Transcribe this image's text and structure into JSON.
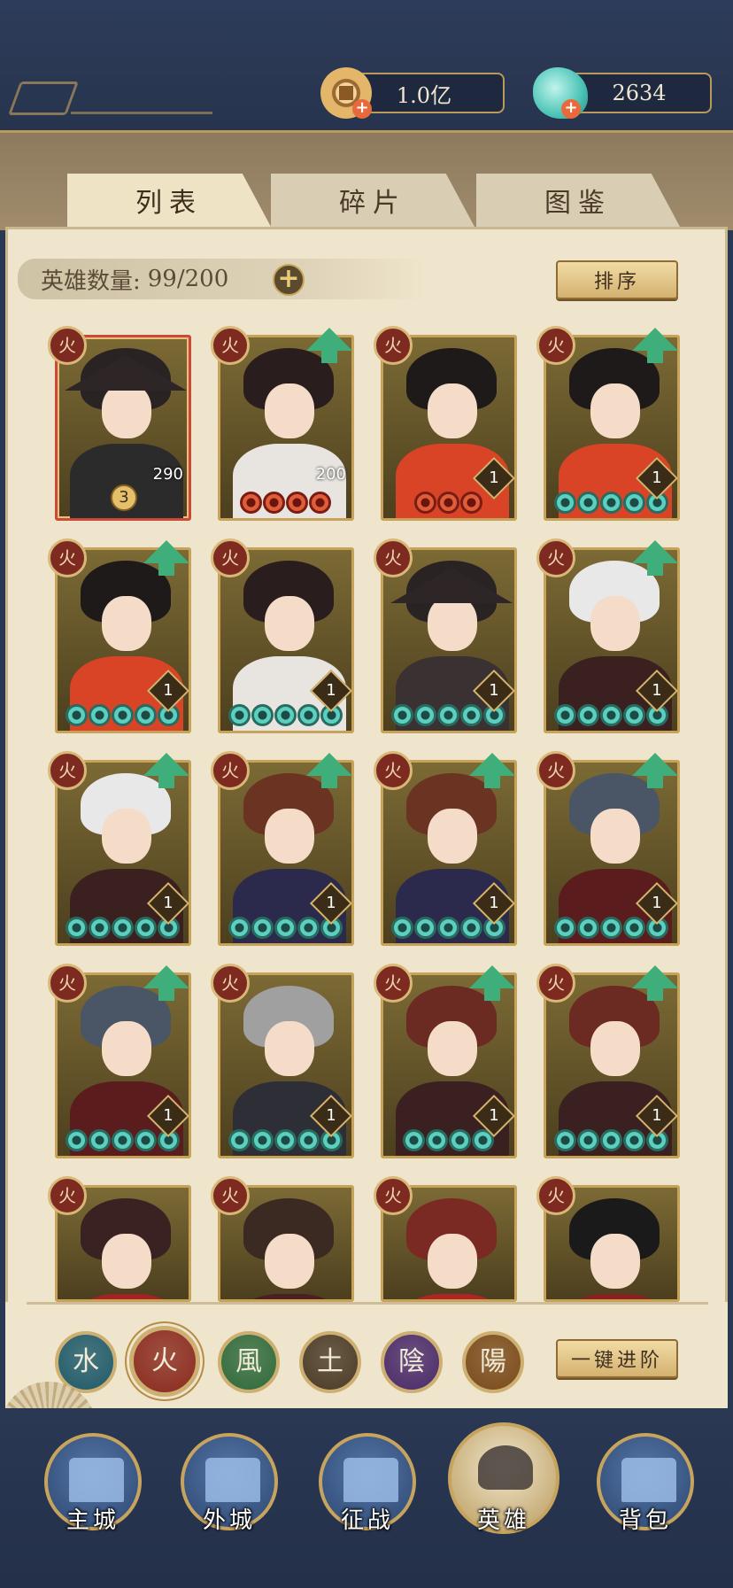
{
  "resources": {
    "coin": {
      "value": "1.0亿",
      "icon": "copper-coin-icon"
    },
    "jade": {
      "value": "2634",
      "icon": "jade-icon"
    }
  },
  "tabs": [
    {
      "label": "列表",
      "active": true
    },
    {
      "label": "碎片",
      "active": false
    },
    {
      "label": "图鉴",
      "active": false
    }
  ],
  "hero_count": {
    "label": "英雄数量:",
    "value": "99/200"
  },
  "sort_label": "排序",
  "onekey_label": "一键进阶",
  "element_glyph": "火",
  "heroes": [
    {
      "row": 0,
      "shards": "290",
      "stars": "3",
      "beads": [],
      "upgrade": false,
      "frame": "red",
      "hair": "#2a2324",
      "robe": "#2b2b2b",
      "hat": true
    },
    {
      "row": 0,
      "shards": "200",
      "level": null,
      "beads": [
        "red",
        "red",
        "red",
        "red"
      ],
      "upgrade": true,
      "frame": "gold",
      "hair": "#2a1d1e",
      "robe": "#e8e4df"
    },
    {
      "row": 0,
      "level": "1",
      "beads": [
        "red",
        "red",
        "red"
      ],
      "upgrade": false,
      "frame": "gold",
      "hair": "#1e1a1a",
      "robe": "#d84425"
    },
    {
      "row": 0,
      "level": "1",
      "beads": [
        "jade",
        "jade",
        "jade",
        "jade",
        "jade"
      ],
      "upgrade": true,
      "frame": "gold",
      "hair": "#1e1a1a",
      "robe": "#d84425"
    },
    {
      "row": 1,
      "level": "1",
      "beads": [
        "jade",
        "jade",
        "jade",
        "jade",
        "jade"
      ],
      "upgrade": true,
      "frame": "gold",
      "hair": "#1e1a1a",
      "robe": "#d84425"
    },
    {
      "row": 1,
      "level": "1",
      "beads": [
        "jade",
        "jade",
        "jade",
        "jade",
        "jade"
      ],
      "upgrade": false,
      "frame": "gold",
      "hair": "#2a1d1e",
      "robe": "#e8e4df"
    },
    {
      "row": 1,
      "level": "1",
      "beads": [
        "jade",
        "jade",
        "jade",
        "jade",
        "jade"
      ],
      "upgrade": false,
      "frame": "gold",
      "hair": "#2a2324",
      "robe": "#3a3232",
      "hat": true
    },
    {
      "row": 1,
      "level": "1",
      "beads": [
        "jade",
        "jade",
        "jade",
        "jade",
        "jade"
      ],
      "upgrade": true,
      "frame": "gold",
      "hair": "#e8e8e8",
      "robe": "#3b2020"
    },
    {
      "row": 2,
      "level": "1",
      "beads": [
        "jade",
        "jade",
        "jade",
        "jade",
        "jade"
      ],
      "upgrade": true,
      "frame": "gold",
      "hair": "#e8e8e8",
      "robe": "#3b2020"
    },
    {
      "row": 2,
      "level": "1",
      "beads": [
        "jade",
        "jade",
        "jade",
        "jade",
        "jade"
      ],
      "upgrade": true,
      "frame": "gold",
      "hair": "#6b3422",
      "robe": "#2c2a4c"
    },
    {
      "row": 2,
      "level": "1",
      "beads": [
        "jade",
        "jade",
        "jade",
        "jade",
        "jade"
      ],
      "upgrade": true,
      "frame": "gold",
      "hair": "#6b3422",
      "robe": "#2c2a4c"
    },
    {
      "row": 2,
      "level": "1",
      "beads": [
        "jade",
        "jade",
        "jade",
        "jade",
        "jade"
      ],
      "upgrade": true,
      "frame": "gold",
      "hair": "#4a5566",
      "robe": "#5a1c1c"
    },
    {
      "row": 3,
      "level": "1",
      "beads": [
        "jade",
        "jade",
        "jade",
        "jade",
        "jade"
      ],
      "upgrade": true,
      "frame": "gold",
      "hair": "#4a5566",
      "robe": "#5a1c1c"
    },
    {
      "row": 3,
      "level": "1",
      "beads": [
        "jade",
        "jade",
        "jade",
        "jade",
        "jade"
      ],
      "upgrade": false,
      "frame": "gold",
      "hair": "#a0a0a0",
      "robe": "#2e2e36"
    },
    {
      "row": 3,
      "level": "1",
      "beads": [
        "jade",
        "jade",
        "jade",
        "jade"
      ],
      "upgrade": true,
      "frame": "gold",
      "hair": "#6b2a22",
      "robe": "#3a2020"
    },
    {
      "row": 3,
      "level": "1",
      "beads": [
        "jade",
        "jade",
        "jade",
        "jade",
        "jade"
      ],
      "upgrade": true,
      "frame": "gold",
      "hair": "#6b2a22",
      "robe": "#3a2020"
    },
    {
      "row": 4,
      "beads": [],
      "upgrade": false,
      "frame": "gold",
      "hair": "#3a2222",
      "robe": "#a52222"
    },
    {
      "row": 4,
      "beads": [],
      "upgrade": false,
      "frame": "gold",
      "hair": "#3a2a22",
      "robe": "#4a2020"
    },
    {
      "row": 4,
      "beads": [],
      "upgrade": false,
      "frame": "gold",
      "hair": "#7a2a22",
      "robe": "#b02424"
    },
    {
      "row": 4,
      "beads": [],
      "upgrade": false,
      "frame": "gold",
      "hair": "#1a1a1a",
      "robe": "#8a2020"
    }
  ],
  "filters": [
    {
      "glyph": "水",
      "color": "#1f5a6a",
      "name": "water-filter",
      "selected": false
    },
    {
      "glyph": "火",
      "color": "#8a2a1e",
      "name": "fire-filter",
      "selected": true
    },
    {
      "glyph": "風",
      "color": "#2f6a3a",
      "name": "wind-filter",
      "selected": false
    },
    {
      "glyph": "土",
      "color": "#4a3a26",
      "name": "earth-filter",
      "selected": false
    },
    {
      "glyph": "陰",
      "color": "#4a2a6a",
      "name": "yin-filter",
      "selected": false
    },
    {
      "glyph": "陽",
      "color": "#7a4a1a",
      "name": "yang-filter",
      "selected": false
    }
  ],
  "nav": [
    {
      "label": "主城",
      "icon": "main-city-icon",
      "active": false
    },
    {
      "label": "外城",
      "icon": "outer-city-icon",
      "active": false
    },
    {
      "label": "征战",
      "icon": "campaign-icon",
      "active": false
    },
    {
      "label": "英雄",
      "icon": "hero-icon",
      "active": true
    },
    {
      "label": "背包",
      "icon": "backpack-icon",
      "active": false
    }
  ],
  "colors": {
    "accent_gold": "#c6a25a",
    "panel": "#efe5cc",
    "navy": "#2a3854",
    "upgrade_green": "#3fae7a"
  }
}
